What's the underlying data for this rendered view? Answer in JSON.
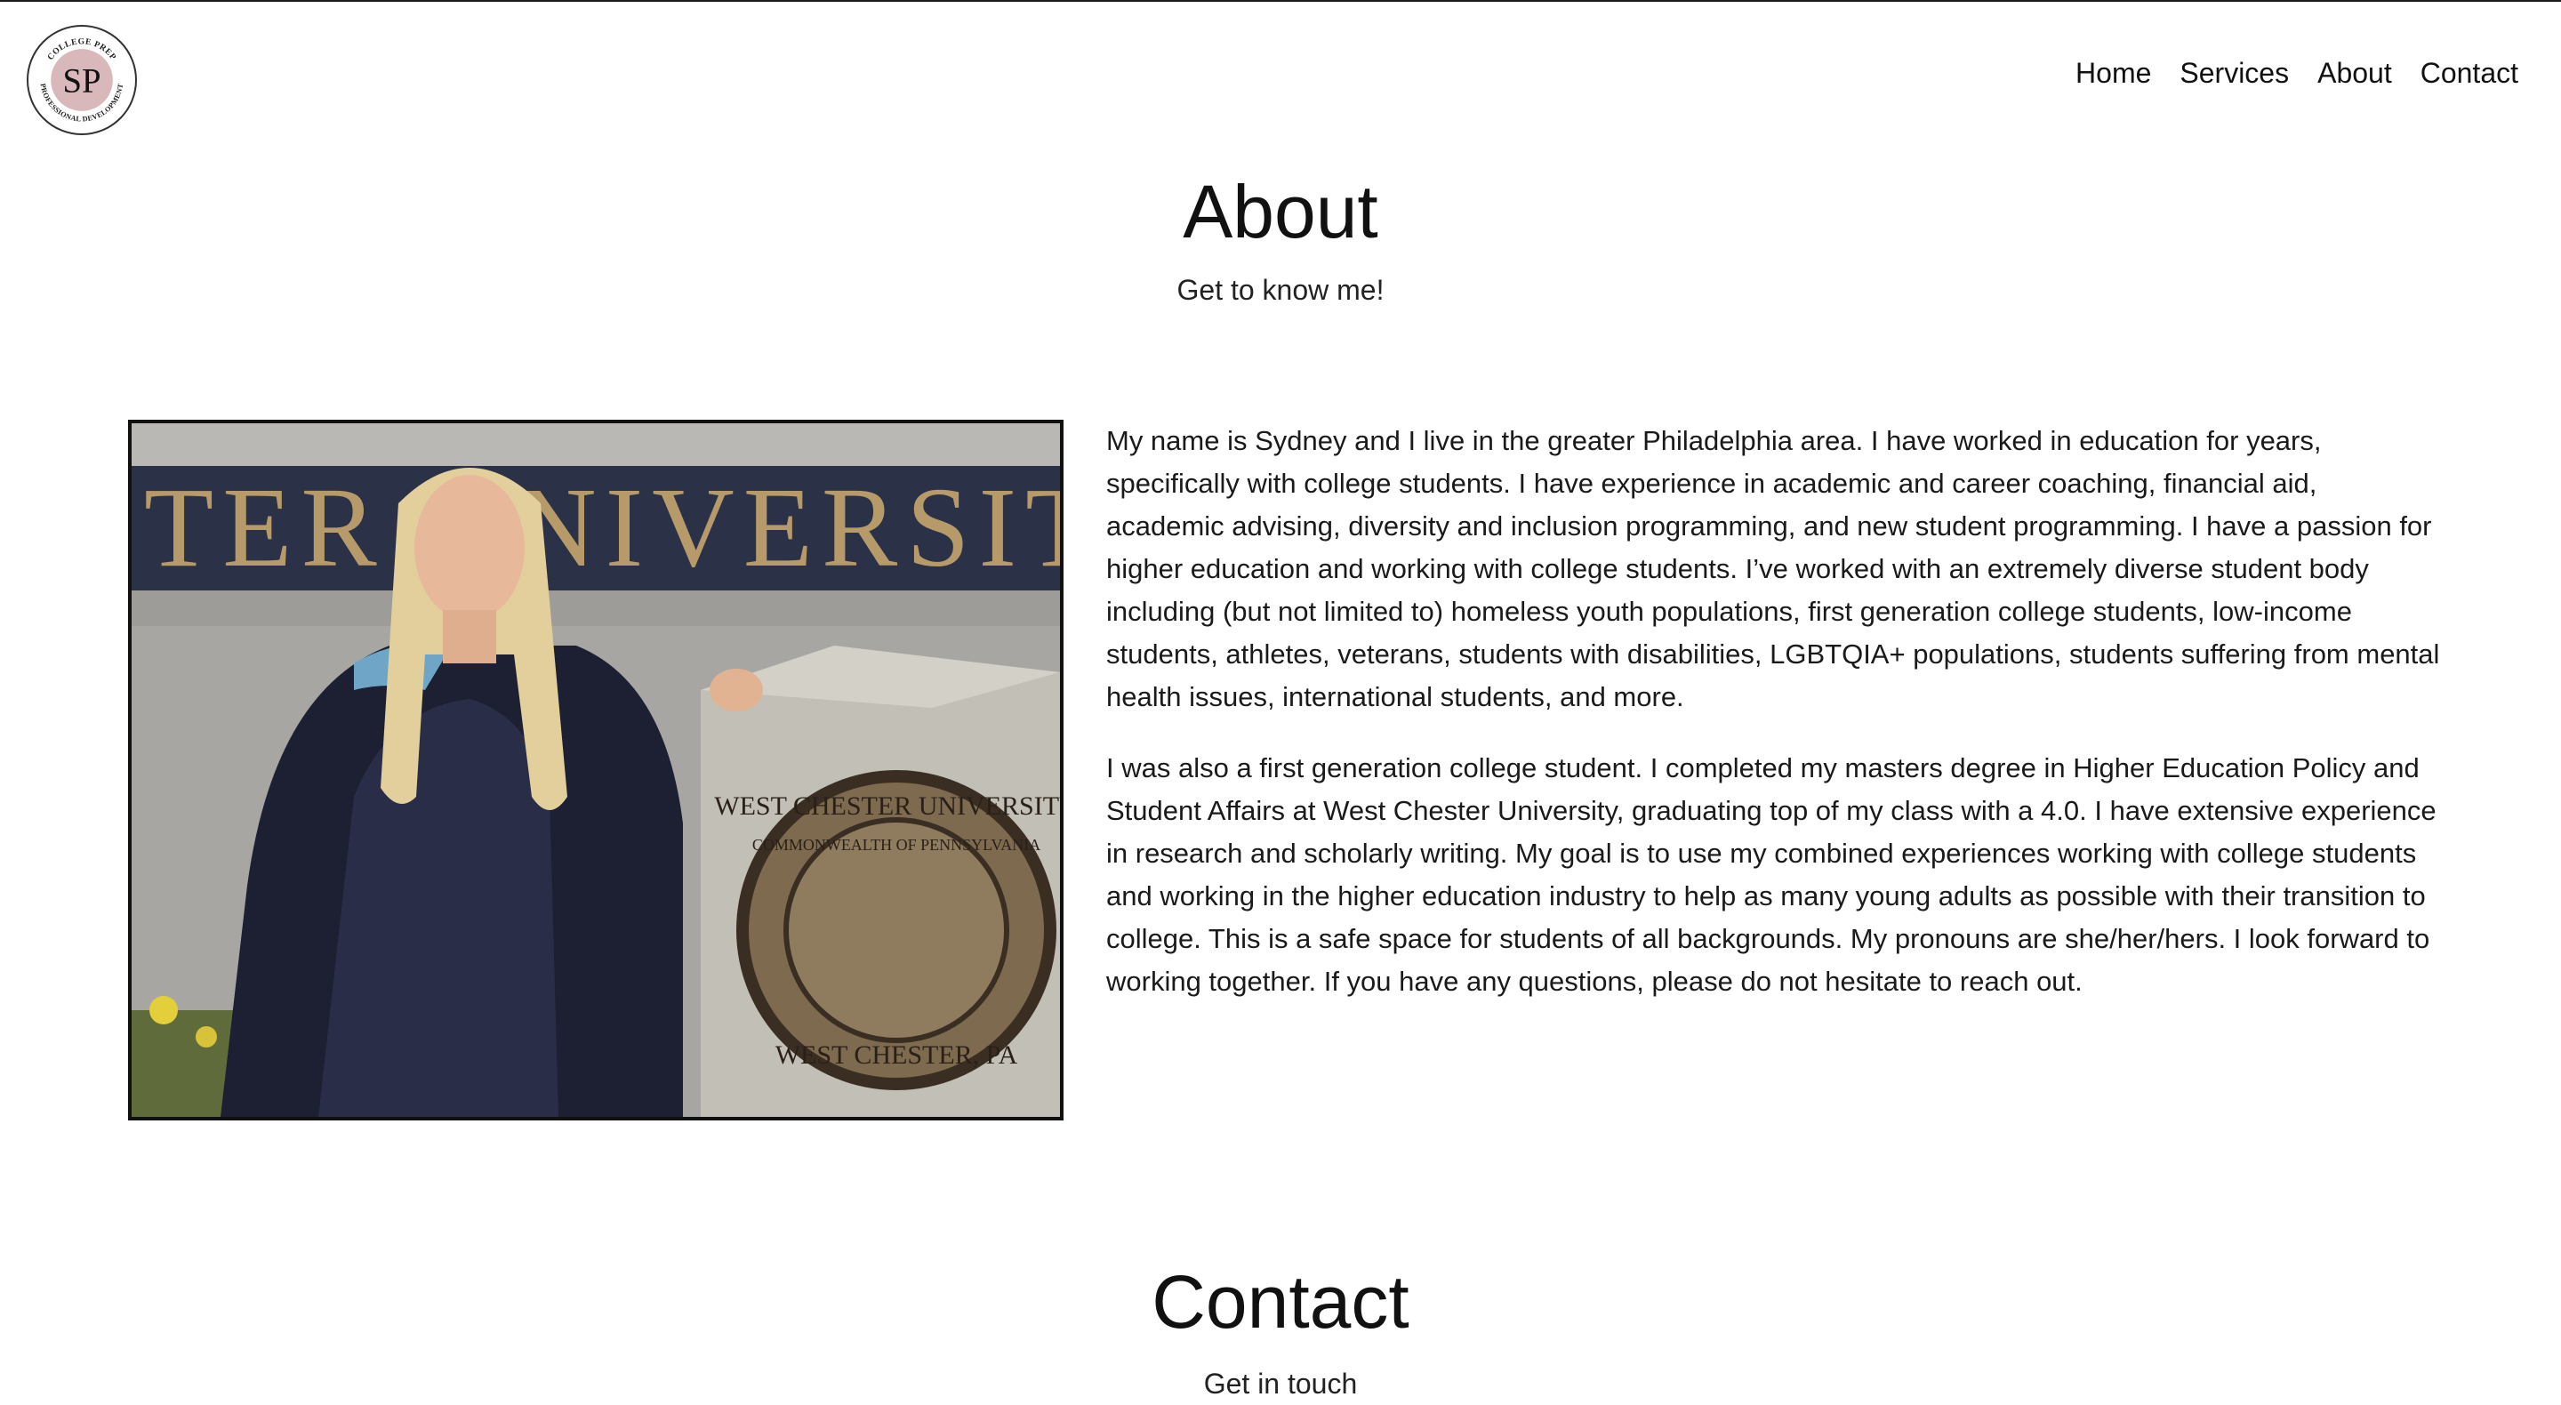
{
  "header": {
    "logo": {
      "initials": "SP",
      "ring_text_top": "COLLEGE PREP",
      "ring_text_bottom": "PROFESSIONAL DEVELOPMENT",
      "circle_color": "#d9b8bb"
    },
    "nav": [
      {
        "label": "Home"
      },
      {
        "label": "Services"
      },
      {
        "label": "About"
      },
      {
        "label": "Contact"
      }
    ]
  },
  "about": {
    "title": "About",
    "subtitle": "Get to know me!",
    "photo": {
      "banner_text": "TER UNIVERSITY",
      "seal_text_top": "WEST CHESTER UNIVERSITY",
      "seal_text_inner": "COMMONWEALTH OF PENNSYLVANIA",
      "seal_text_bottom": "WEST CHESTER, PA"
    },
    "paragraphs": [
      "My name is Sydney and I live in the greater Philadelphia area. I have worked in education for years, specifically with college students. I have experience in academic and career coaching, financial aid, academic advising, diversity and inclusion programming, and new student programming. I have a passion for higher education and working with college students. I’ve worked with an extremely diverse student body including (but not limited to) homeless youth populations, first generation college students, low-income students, athletes, veterans, students with disabilities, LGBTQIA+ populations, students suffering from mental health issues, international students, and more.",
      "I was also a first generation college student. I completed my masters degree in Higher Education Policy and Student Affairs at West Chester University, graduating top of my class with a 4.0. I have extensive experience in research and scholarly writing. My goal is to use my combined experiences working with college students and working in the higher education industry to help as many young adults as possible with their transition to college. This is a safe space for students of all backgrounds. My pronouns are she/her/hers. I look forward to working together. If you have any questions, please do not hesitate to reach out."
    ]
  },
  "contact": {
    "title": "Contact",
    "subtitle": "Get in touch"
  }
}
